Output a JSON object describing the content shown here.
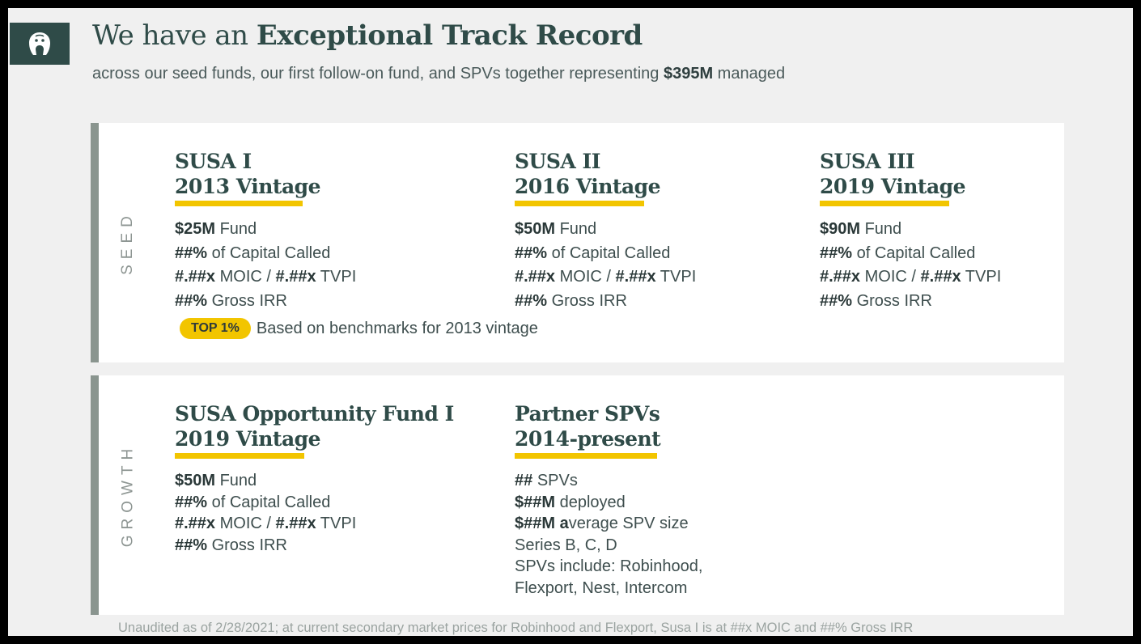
{
  "colors": {
    "accent": "#f2c500",
    "brand": "#2f4b48",
    "panel_bar": "#8a958f"
  },
  "logo": {
    "icon": "gorilla-logo-icon"
  },
  "header": {
    "title_prefix": "We have an",
    "title_bold": "Exceptional Track Record",
    "subtitle_prefix": "across our seed funds, our first follow-on fund, and SPVs together representing",
    "subtitle_amount": "$395M",
    "subtitle_suffix": "managed"
  },
  "seed": {
    "label": "SEED",
    "funds": [
      {
        "name": "SUSA I",
        "vintage": "2013 Vintage",
        "fund_amount": "$25M",
        "fund_label": "Fund",
        "capital_bold": "##%",
        "capital_label": "of Capital Called",
        "moic_bold": "#.##x",
        "moic_label": "MOIC /",
        "tvpi_bold": "#.##x",
        "tvpi_label": "TVPI",
        "irr_bold": "##%",
        "irr_label": "Gross IRR"
      },
      {
        "name": "SUSA II",
        "vintage": "2016 Vintage",
        "fund_amount": "$50M",
        "fund_label": "Fund",
        "capital_bold": "##%",
        "capital_label": "of Capital Called",
        "moic_bold": "#.##x",
        "moic_label": "MOIC /",
        "tvpi_bold": "#.##x",
        "tvpi_label": "TVPI",
        "irr_bold": "##%",
        "irr_label": "Gross IRR"
      },
      {
        "name": "SUSA III",
        "vintage": "2019 Vintage",
        "fund_amount": "$90M",
        "fund_label": "Fund",
        "capital_bold": "##%",
        "capital_label": "of Capital Called",
        "moic_bold": "#.##x",
        "moic_label": "MOIC /",
        "tvpi_bold": "#.##x",
        "tvpi_label": "TVPI",
        "irr_bold": "##%",
        "irr_label": "Gross IRR"
      }
    ],
    "badge": "TOP 1%",
    "badge_text": "Based on benchmarks for 2013 vintage"
  },
  "growth": {
    "label": "GROWTH",
    "opportunity": {
      "name": "SUSA Opportunity Fund I",
      "vintage": "2019 Vintage",
      "fund_amount": "$50M",
      "fund_label": "Fund",
      "capital_bold": "##%",
      "capital_label": "of Capital Called",
      "moic_bold": "#.##x",
      "moic_label": "MOIC /",
      "tvpi_bold": "#.##x",
      "tvpi_label": "TVPI",
      "irr_bold": "##%",
      "irr_label": "Gross IRR"
    },
    "spvs": {
      "name": "Partner SPVs",
      "vintage": "2014-present",
      "count_bold": "##",
      "count_label": "SPVs",
      "deployed_bold": "$##M",
      "deployed_label": "deployed",
      "avg_bold": "$##M a",
      "avg_label": "verage SPV size",
      "series": "Series B, C, D",
      "includes_1": "SPVs include: Robinhood,",
      "includes_2": "Flexport, Nest, Intercom"
    }
  },
  "footnote": "Unaudited as of 2/28/2021; at current secondary market prices for Robinhood and Flexport, Susa I is at ##x MOIC and ##% Gross IRR"
}
